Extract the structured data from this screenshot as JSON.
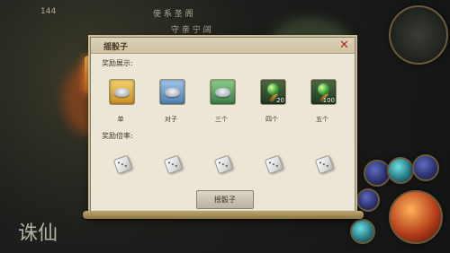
{
  "background": {
    "level_text": "144",
    "top_text": "守 亲 宁 阔",
    "top_label": "使 系 圣 阁",
    "logo_text": "诛仙"
  },
  "dialog": {
    "title": "摇骰子",
    "close_icon": "close-icon",
    "reward_display_label": "奖励展示:",
    "reward_rate_label": "奖励倍率:",
    "rewards": [
      {
        "caption": "单",
        "type": "silver-ingot",
        "qty": ""
      },
      {
        "caption": "对子",
        "type": "silver-ingot",
        "qty": ""
      },
      {
        "caption": "三个",
        "type": "silver-ingot",
        "qty": ""
      },
      {
        "caption": "四个",
        "type": "green-orb",
        "qty": "20"
      },
      {
        "caption": "五个",
        "type": "green-orb",
        "qty": "100"
      }
    ],
    "dice_count": 5,
    "roll_button_label": "摇骰子"
  }
}
